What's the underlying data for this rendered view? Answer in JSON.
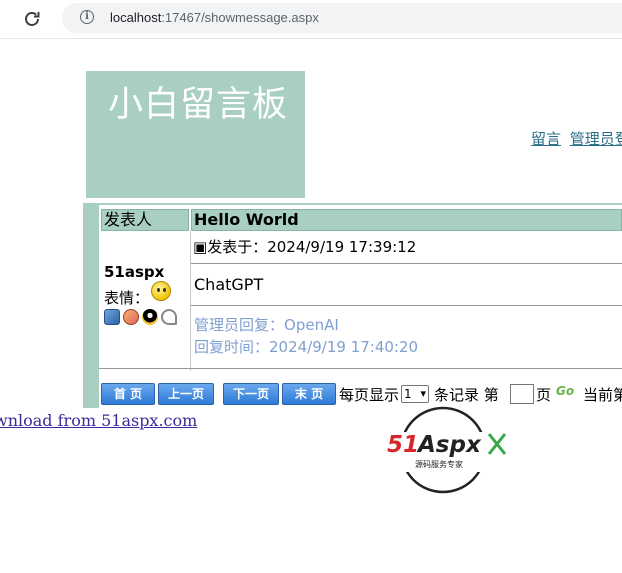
{
  "browser": {
    "url_host": "localhost",
    "url_rest": ":17467/showmessage.aspx"
  },
  "header": {
    "title": "小白留言板",
    "links": [
      "留言",
      "管理员登"
    ]
  },
  "table": {
    "col_author": "发表人",
    "message_title": "Hello World"
  },
  "message": {
    "author": "51aspx",
    "mood_label": "表情：",
    "posted_label": "发表于：",
    "posted_time": "2024/9/19 17:39:12",
    "content": "ChatGPT",
    "reply_label": "管理员回复：",
    "reply_text": "OpenAI",
    "reply_time_label": "回复时间：",
    "reply_time": "2024/9/19 17:40:20",
    "contact_icons": [
      "computer-icon",
      "home-icon",
      "qq-icon",
      "phone-icon"
    ]
  },
  "pager": {
    "first": "首 页",
    "prev": "上一页",
    "next": "下一页",
    "last": "末 页",
    "per_page_label": "每页显示",
    "per_page_value": "1",
    "records_label": "条记录 第",
    "page_label": "页",
    "go": "Go",
    "current_label": "当前第"
  },
  "footer": {
    "download_link": "wnload from 51aspx.com"
  },
  "logo": {
    "brand_text": "51Aspx",
    "tagline": "源码服务专家"
  },
  "colors": {
    "accent": "#a8cfc2",
    "link": "#2a6f8a",
    "reply": "#7f9fd1",
    "button": "#2d7ad6"
  }
}
